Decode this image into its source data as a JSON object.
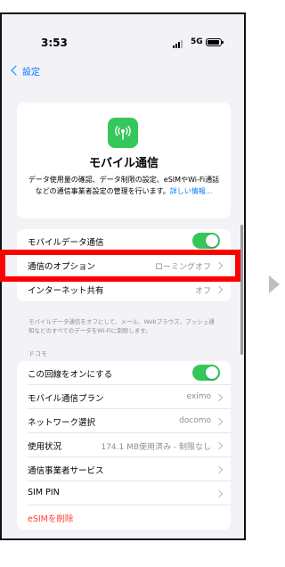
{
  "status_bar": {
    "time": "3:53",
    "network": "5G"
  },
  "nav": {
    "back_label": "設定"
  },
  "hero": {
    "icon": "cellular-antenna-icon",
    "title": "モバイル通信",
    "description": "データ使用量の確認、データ制限の設定、eSIMやWi-Fi通話などの通信事業者設定の管理を行います。",
    "learn_more": "詳しい情報..."
  },
  "section1": {
    "rows": [
      {
        "label": "モバイルデータ通信",
        "toggle": true
      },
      {
        "label": "通信のオプション",
        "value": "ローミングオフ"
      },
      {
        "label": "インターネット共有",
        "value": "オフ"
      }
    ],
    "footer": "モバイルデータ通信をオフにして、メール、Webブラウズ、プッシュ通知などのすべてのデータをWi-Fiに制限します。"
  },
  "section2": {
    "header": "ドコモ",
    "rows": [
      {
        "label": "この回線をオンにする",
        "toggle": true
      },
      {
        "label": "モバイル通信プラン",
        "value": "eximo"
      },
      {
        "label": "ネットワーク選択",
        "value": "docomo"
      },
      {
        "label": "使用状況",
        "value": "174.1 MB使用済み - 制限なし"
      },
      {
        "label": "通信事業者サービス"
      },
      {
        "label": "SIM PIN"
      },
      {
        "label": "eSIMを削除"
      }
    ]
  },
  "colors": {
    "accent": "#0a7cff",
    "toggle_on": "#34c759",
    "highlight": "#ff0000",
    "danger": "#ff3b30"
  }
}
